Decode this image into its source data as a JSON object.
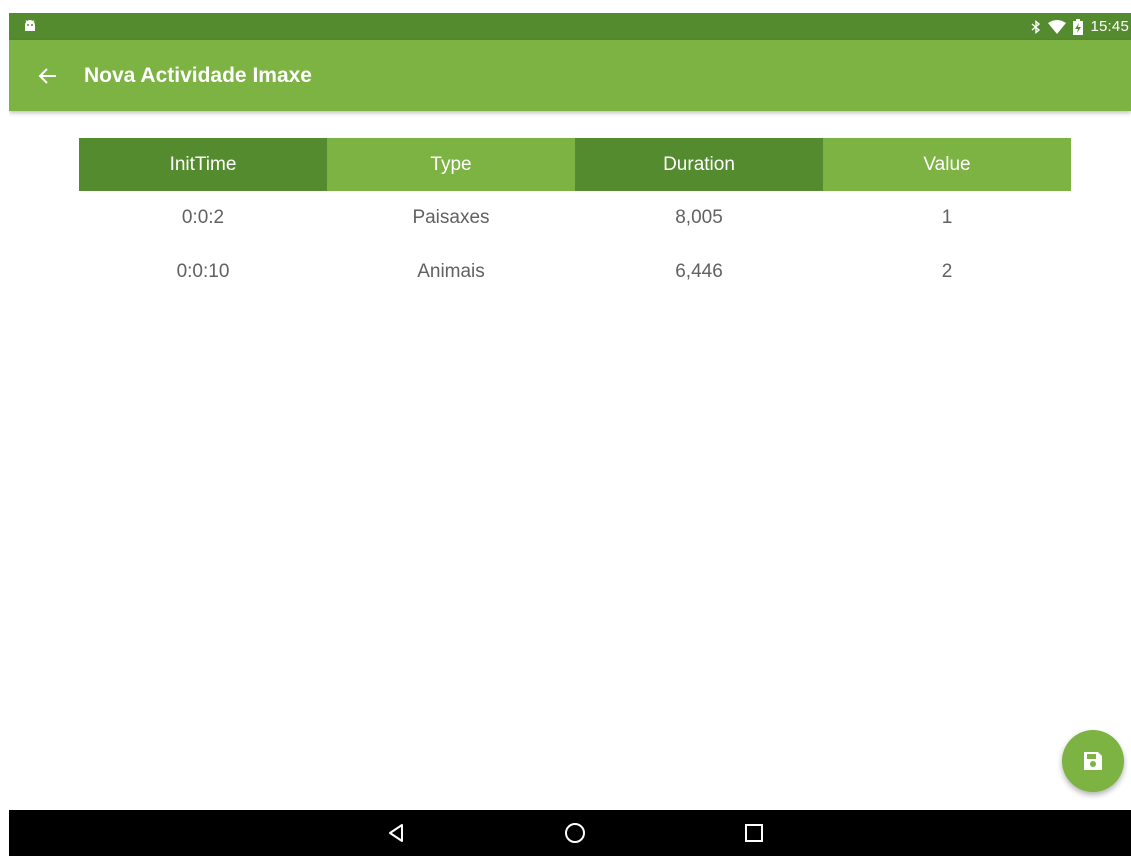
{
  "status_bar": {
    "time": "15:45",
    "icons": [
      "android-notification-icon",
      "bluetooth-icon",
      "wifi-icon",
      "battery-charging-icon"
    ]
  },
  "app_bar": {
    "title": "Nova Actividade Imaxe",
    "back_icon": "arrow-back-icon"
  },
  "table": {
    "headers": [
      "InitTime",
      "Type",
      "Duration",
      "Value"
    ],
    "rows": [
      [
        "0:0:2",
        "Paisaxes",
        "8,005",
        "1"
      ],
      [
        "0:0:10",
        "Animais",
        "6,446",
        "2"
      ]
    ]
  },
  "fab": {
    "icon": "save-icon"
  },
  "nav_bar": {
    "icons": [
      "nav-back-icon",
      "nav-home-icon",
      "nav-recents-icon"
    ]
  },
  "colors": {
    "primary": "#7cb342",
    "primary_dark": "#558b2f",
    "text_secondary": "#616161",
    "nav_background": "#000000"
  }
}
